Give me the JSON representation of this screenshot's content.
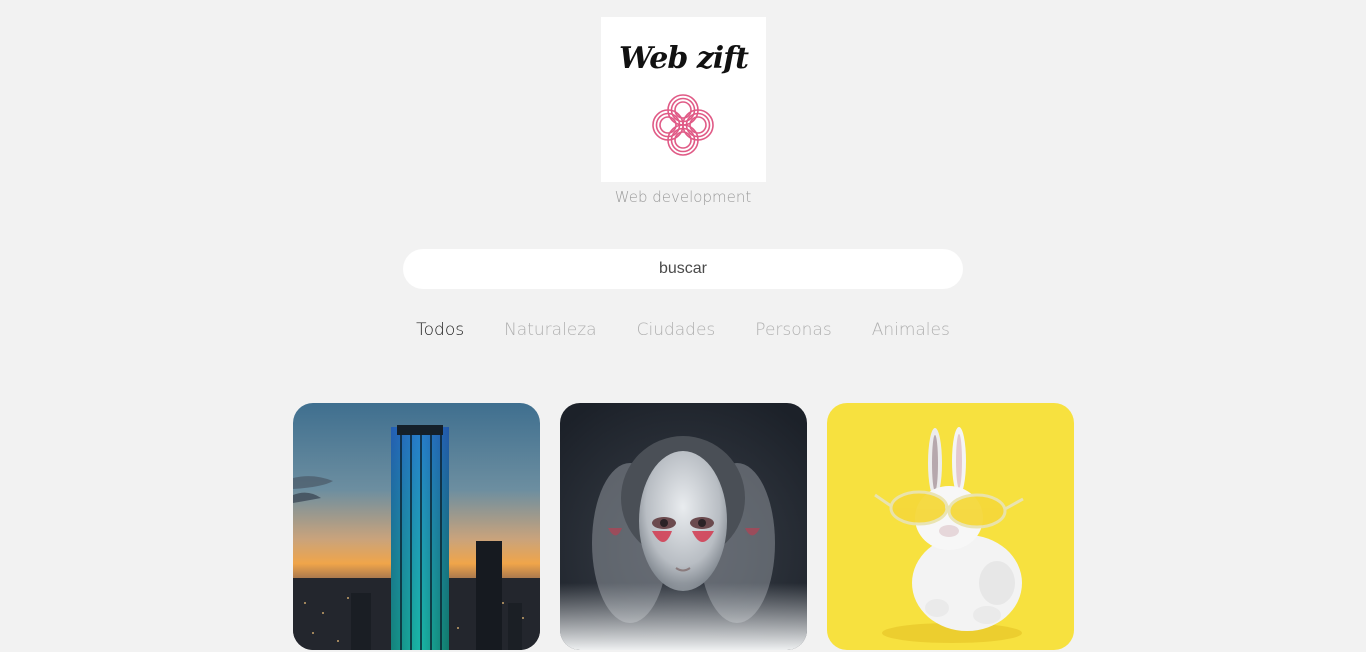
{
  "brand": {
    "logo_text": "Web zift",
    "tagline": "Web development",
    "knot_color": "#e05a86"
  },
  "search": {
    "placeholder": "buscar",
    "value": ""
  },
  "filters": [
    {
      "label": "Todos",
      "active": true
    },
    {
      "label": "Naturaleza",
      "active": false
    },
    {
      "label": "Ciudades",
      "active": false
    },
    {
      "label": "Personas",
      "active": false
    },
    {
      "label": "Animales",
      "active": false
    }
  ],
  "gallery": [
    {
      "subject": "city-skyline-photo",
      "category": "Ciudades"
    },
    {
      "subject": "portrait-photo",
      "category": "Personas"
    },
    {
      "subject": "rabbit-with-glasses-photo",
      "category": "Animales"
    }
  ],
  "colors": {
    "background": "#f2f2f2",
    "active_filter": "#1c1c1c",
    "inactive_filter": "#b0b0b0",
    "accent_yellow": "#f7e13f"
  }
}
